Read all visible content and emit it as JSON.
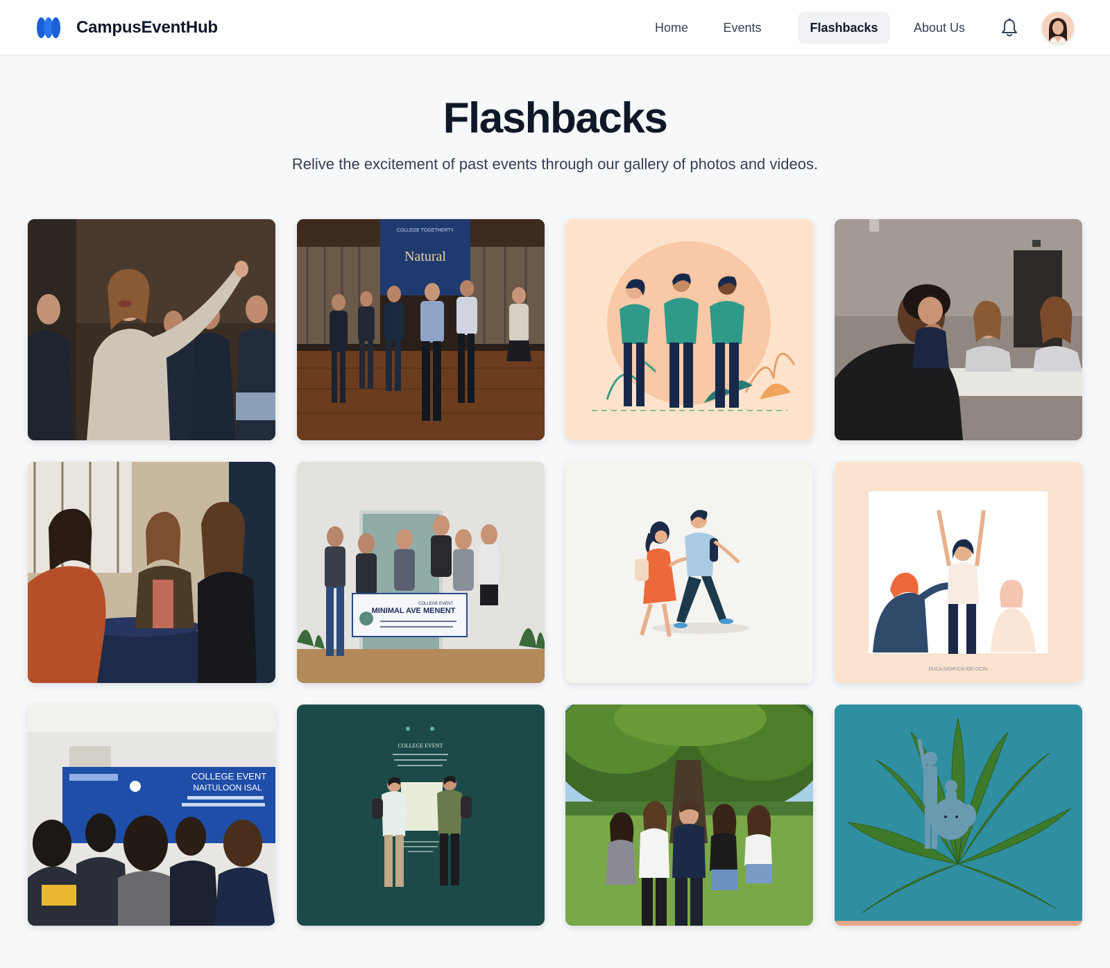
{
  "app": {
    "name": "CampusEventHub"
  },
  "nav": {
    "home": "Home",
    "events": "Events",
    "flashbacks": "Flashbacks",
    "about": "About Us"
  },
  "hero": {
    "title": "Flashbacks",
    "subtitle": "Relive the excitement of past events through our gallery of photos and videos."
  },
  "colors": {
    "brand": "#1a5fd6",
    "text": "#101828",
    "page_bg": "#f7f8fa",
    "active_tab_bg": "#f0f2f5"
  },
  "gallery": {
    "tiles": [
      {
        "name": "cheering-crowd-photo"
      },
      {
        "name": "dance-event-photo",
        "banner_title": "Natural",
        "banner_small": "COLLEGE TOGETHERTY"
      },
      {
        "name": "friends-illustration"
      },
      {
        "name": "discussion-table-photo"
      },
      {
        "name": "student-mixer-photo"
      },
      {
        "name": "group-banner-photo",
        "banner_title": "MINIMAL AVE MENENT",
        "banner_small": "COLLEGE EVENT"
      },
      {
        "name": "walking-couple-illustration"
      },
      {
        "name": "celebration-illustration",
        "caption": "DUCA NIDIFICA IOD OCIN"
      },
      {
        "name": "college-event-booth-photo",
        "banner_title": "COLLEGE EVENT",
        "banner_sub": "NAITULOON ISAL"
      },
      {
        "name": "college-event-poster",
        "poster_title": "COLLEGE EVENT"
      },
      {
        "name": "tree-group-photo"
      },
      {
        "name": "palm-statue-photo"
      }
    ]
  }
}
